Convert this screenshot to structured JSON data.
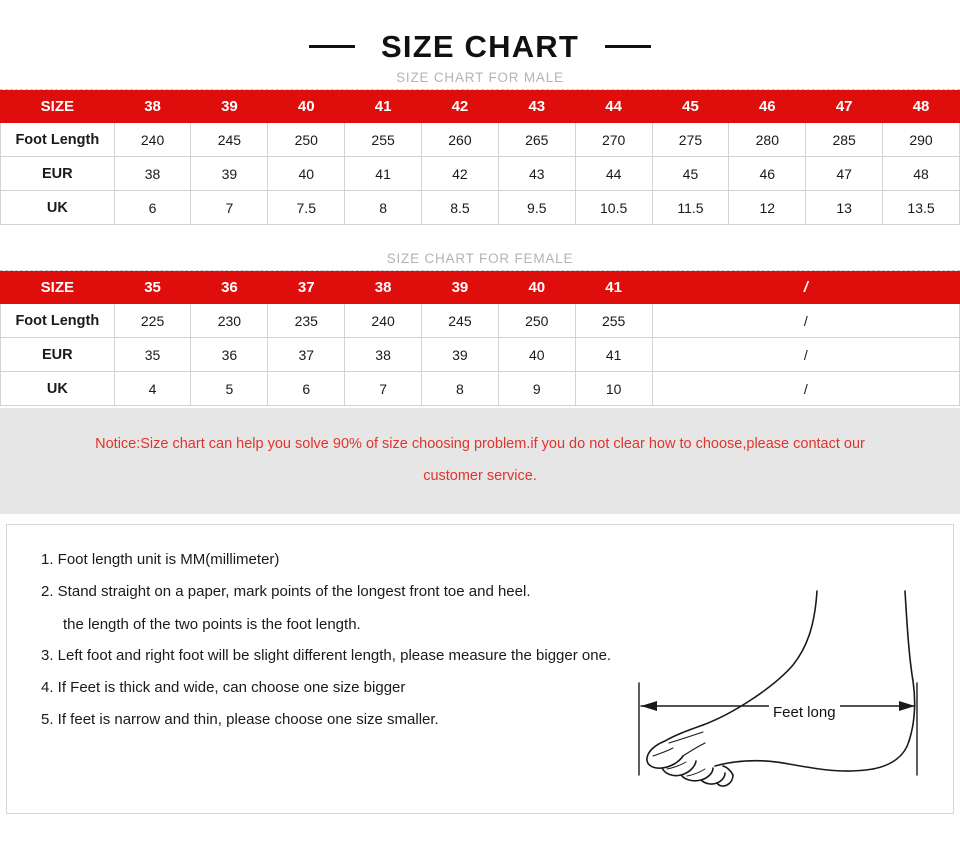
{
  "header": {
    "title": "SIZE CHART",
    "left_dash": "dash",
    "right_dash": "dash"
  },
  "colors": {
    "accent_red": "#e00d0d",
    "notice_red": "#e0342c",
    "notice_band_bg": "#e6e6e6",
    "caption_gray": "#b4b4b4",
    "border_gray": "#d2d2d2"
  },
  "male_table": {
    "caption": "SIZE CHART FOR MALE",
    "rows": [
      {
        "type": "header",
        "label": "SIZE",
        "values": [
          "38",
          "39",
          "40",
          "41",
          "42",
          "43",
          "44",
          "45",
          "46",
          "47",
          "48"
        ]
      },
      {
        "type": "data",
        "label": "Foot Length",
        "values": [
          "240",
          "245",
          "250",
          "255",
          "260",
          "265",
          "270",
          "275",
          "280",
          "285",
          "290"
        ]
      },
      {
        "type": "data",
        "label": "EUR",
        "values": [
          "38",
          "39",
          "40",
          "41",
          "42",
          "43",
          "44",
          "45",
          "46",
          "47",
          "48"
        ]
      },
      {
        "type": "data",
        "label": "UK",
        "values": [
          "6",
          "7",
          "7.5",
          "8",
          "8.5",
          "9.5",
          "10.5",
          "11.5",
          "12",
          "13",
          "13.5"
        ]
      }
    ]
  },
  "female_table": {
    "caption": "SIZE CHART FOR FEMALE",
    "merged_value": "/",
    "rows": [
      {
        "type": "header",
        "label": "SIZE",
        "values": [
          "35",
          "36",
          "37",
          "38",
          "39",
          "40",
          "41"
        ],
        "merged": "/"
      },
      {
        "type": "data",
        "label": "Foot Length",
        "values": [
          "225",
          "230",
          "235",
          "240",
          "245",
          "250",
          "255"
        ],
        "merged": "/"
      },
      {
        "type": "data",
        "label": "EUR",
        "values": [
          "35",
          "36",
          "37",
          "38",
          "39",
          "40",
          "41"
        ],
        "merged": "/"
      },
      {
        "type": "data",
        "label": "UK",
        "values": [
          "4",
          "5",
          "6",
          "7",
          "8",
          "9",
          "10"
        ],
        "merged": "/"
      }
    ]
  },
  "notice": {
    "line1": "Notice:Size chart can help you solve 90% of size choosing problem.if you do not clear how to choose,please contact our",
    "line2": "customer service."
  },
  "instructions": {
    "items": [
      {
        "text": "1. Foot length unit is MM(millimeter)",
        "continuation": null
      },
      {
        "text": "2. Stand straight on a paper, mark points of the longest front toe and heel.",
        "continuation": "the length of the two points is the foot length."
      },
      {
        "text": "3. Left foot and right foot will be slight different length, please measure the bigger one.",
        "continuation": null
      },
      {
        "text": "4. If Feet is thick and wide, can choose one size bigger",
        "continuation": null
      },
      {
        "text": "5. If feet is narrow and thin, please choose one size smaller.",
        "continuation": null
      }
    ]
  },
  "figure": {
    "measure_label": "Feet long",
    "icon": "foot-side-profile"
  }
}
